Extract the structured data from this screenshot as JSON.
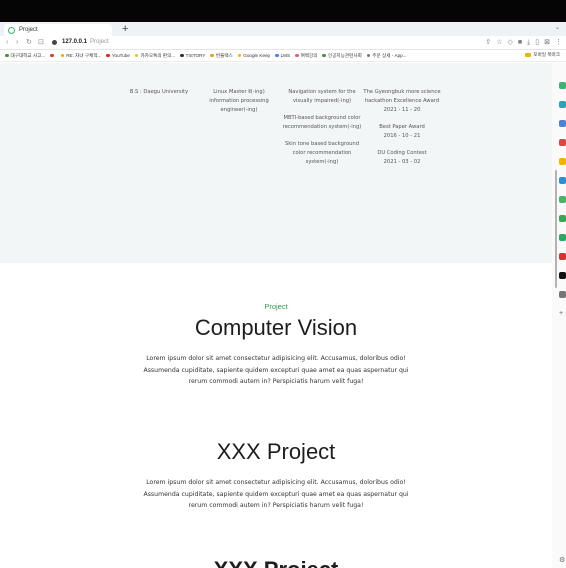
{
  "browser": {
    "tab_title": "Project",
    "new_tab_glyph": "+",
    "tab_menu_glyph": "⌄",
    "url_host": "127.0.0.1",
    "url_title": "Project",
    "bookmarks": [
      {
        "label": "대구대학교 사고...",
        "color": "#4a8f3c"
      },
      {
        "label": "",
        "color": "#d83b3b"
      },
      {
        "label": "RE: 자녀 구체적...",
        "color": "#e8a317"
      },
      {
        "label": "YouTube",
        "color": "#e62117"
      },
      {
        "label": "카카오톡의 판의...",
        "color": "#f2c300"
      },
      {
        "label": "TISTORY",
        "color": "#333333"
      },
      {
        "label": "번플렉스",
        "color": "#e8a317"
      },
      {
        "label": "Google Keep",
        "color": "#f4b400"
      },
      {
        "label": "LMS",
        "color": "#4285f4"
      },
      {
        "label": "여백강의",
        "color": "#e06666"
      },
      {
        "label": "인공지능관련사회",
        "color": "#4a8f3c"
      },
      {
        "label": "주문 상세 - App...",
        "color": "#777777"
      }
    ],
    "bookmark_folder": "모바일 북마크"
  },
  "about": {
    "education": [
      "B.S : Daegu University"
    ],
    "certificates": [
      "Linux Master Ⅱ(-ing)",
      "information processing",
      "engineer(-ing)"
    ],
    "projects": [
      [
        "Navigation system for the",
        "visually impaired(-ing)"
      ],
      [
        "MBTI-based background color",
        "recommendation system(-ing)"
      ],
      [
        "Skin tone based background",
        "color recommendation",
        "system(-ing)"
      ]
    ],
    "awards": [
      [
        "The Gyeongbuk more science",
        "hackathon Excellence Award",
        "2021 - 11 - 20"
      ],
      [
        "Best Paper Award",
        "2016 - 10 - 21"
      ],
      [
        "DU Coding Contest",
        "2021 - 03 - 02"
      ]
    ]
  },
  "main": {
    "eyebrow": "Project",
    "projects": [
      {
        "title": "Computer Vision",
        "description": "Lorem ipsum dolor sit amet consectetur adipisicing elit. Accusamus, doloribus odio! Assumenda cupiditate, sapiente quidem excepturi quae amet ea quas aspernatur qui rerum commodi autem in? Perspiciatis harum velit fuga!"
      },
      {
        "title": "XXX Project",
        "description": "Lorem ipsum dolor sit amet consectetur adipisicing elit. Accusamus, doloribus odio! Assumenda cupiditate, sapiente quidem excepturi quae amet ea quas aspernatur qui rerum commodi autem in? Perspiciatis harum velit fuga!"
      },
      {
        "title": "XXX Project"
      }
    ]
  },
  "extensions": [
    "#3cb371",
    "#27a4b5",
    "#4d7fd6",
    "#e04343",
    "#f0b400",
    "#2a8fd6",
    "#43b764",
    "#34a853",
    "#2aa866",
    "#d93030",
    "#111111",
    "#777777"
  ],
  "colors": {
    "accent": "#2e9b52",
    "about_bg": "#f3f6f6"
  }
}
